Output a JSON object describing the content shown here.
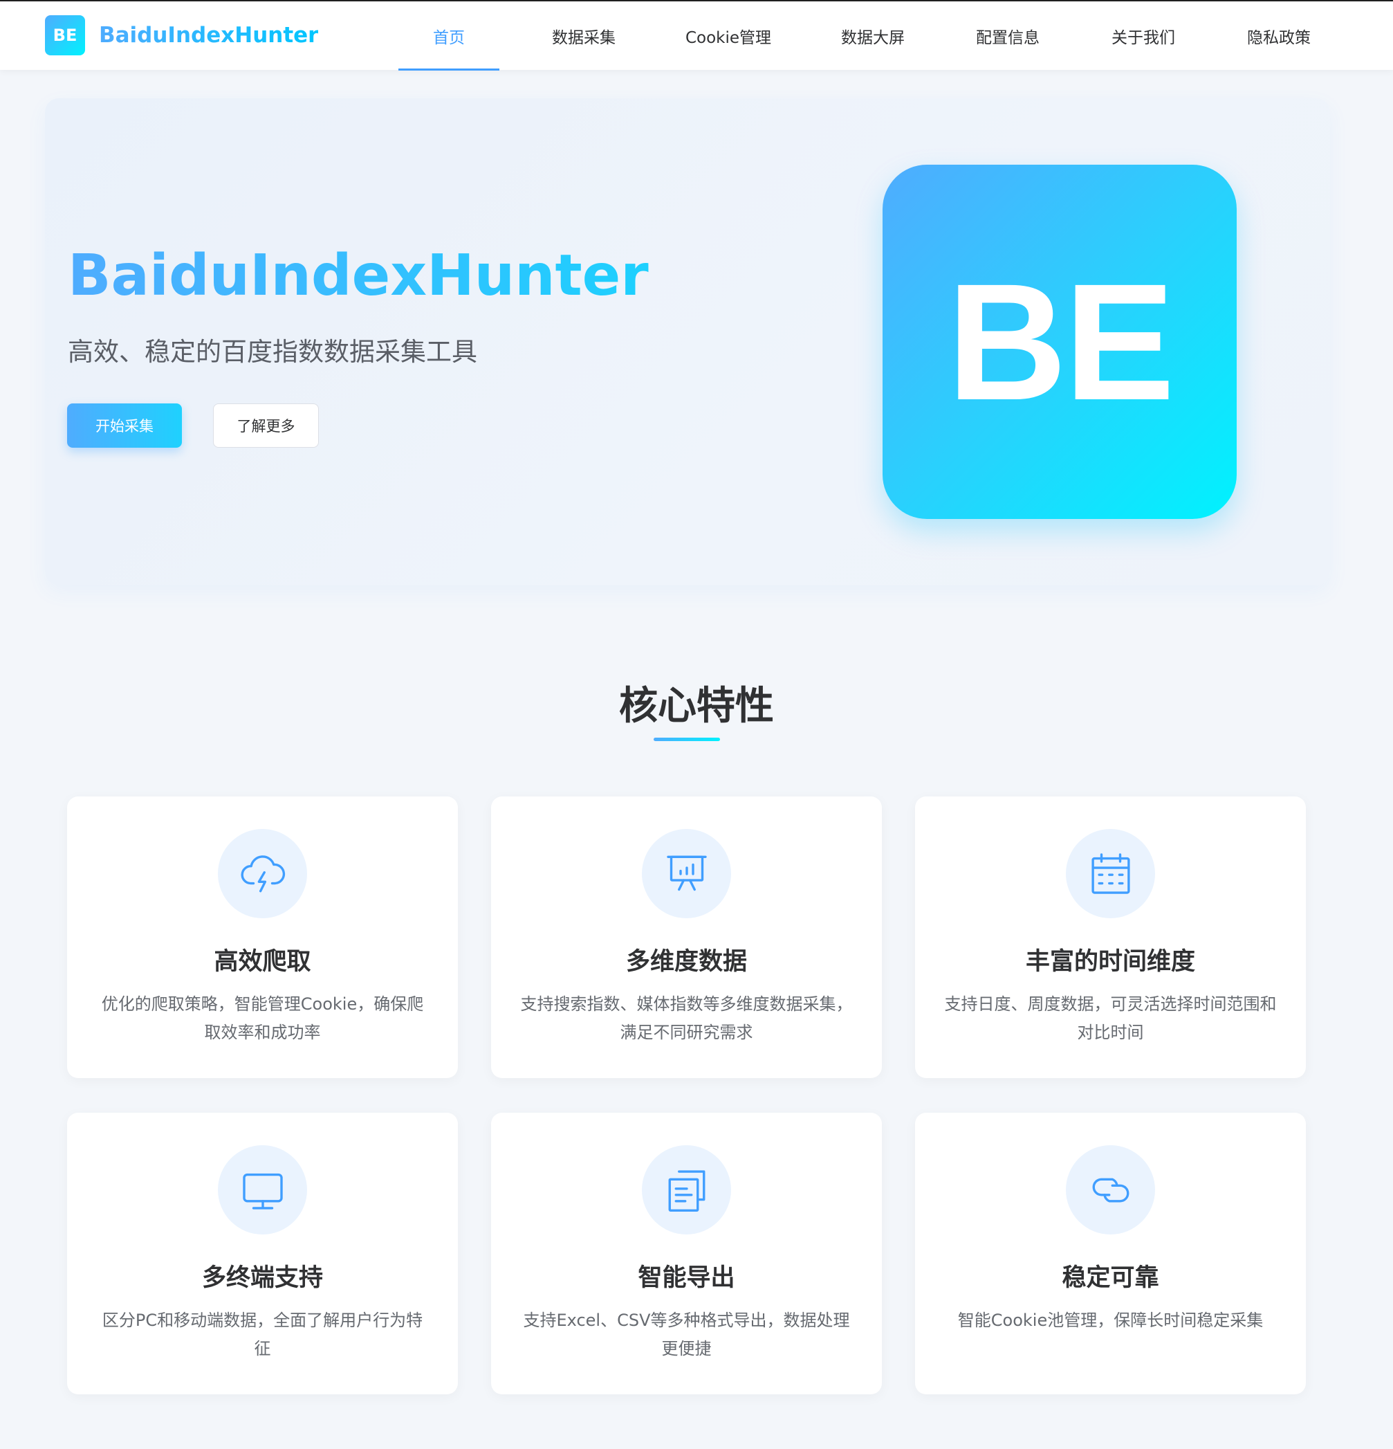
{
  "header": {
    "logo_text": "BE",
    "brand_name": "BaiduIndexHunter",
    "nav": [
      {
        "label": "首页",
        "active": true
      },
      {
        "label": "数据采集",
        "active": false
      },
      {
        "label": "Cookie管理",
        "active": false
      },
      {
        "label": "数据大屏",
        "active": false
      },
      {
        "label": "配置信息",
        "active": false
      },
      {
        "label": "关于我们",
        "active": false
      },
      {
        "label": "隐私政策",
        "active": false
      }
    ]
  },
  "hero": {
    "title": "BaiduIndexHunter",
    "subtitle": "高效、稳定的百度指数数据采集工具",
    "primary_button": "开始采集",
    "secondary_button": "了解更多",
    "logo_text": "BE"
  },
  "features": {
    "title": "核心特性",
    "cards": [
      {
        "icon": "cloud-lightning-icon",
        "title": "高效爬取",
        "desc": "优化的爬取策略，智能管理Cookie，确保爬取效率和成功率"
      },
      {
        "icon": "presentation-chart-icon",
        "title": "多维度数据",
        "desc": "支持搜索指数、媒体指数等多维度数据采集，满足不同研究需求"
      },
      {
        "icon": "calendar-icon",
        "title": "丰富的时间维度",
        "desc": "支持日度、周度数据，可灵活选择时间范围和对比时间"
      },
      {
        "icon": "monitor-icon",
        "title": "多终端支持",
        "desc": "区分PC和移动端数据，全面了解用户行为特征"
      },
      {
        "icon": "copy-document-icon",
        "title": "智能导出",
        "desc": "支持Excel、CSV等多种格式导出，数据处理更便捷"
      },
      {
        "icon": "link-icon",
        "title": "稳定可靠",
        "desc": "智能Cookie池管理，保障长时间稳定采集"
      }
    ]
  },
  "colors": {
    "accent": "#409eff",
    "gradient_start": "#4facfe",
    "gradient_end": "#00f2fe",
    "page_bg": "#f3f6fa"
  }
}
